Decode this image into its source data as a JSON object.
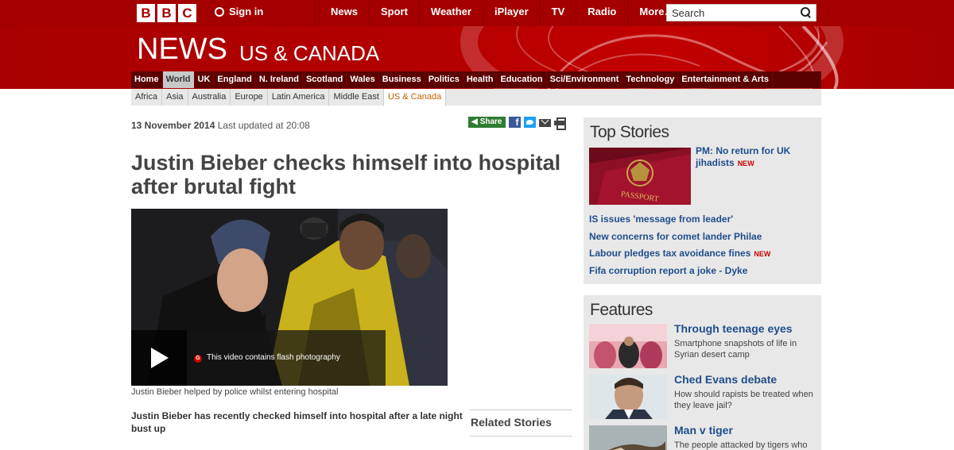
{
  "topbar": {
    "logo_letters": [
      "B",
      "B",
      "C"
    ],
    "signin_label": "Sign in",
    "nav": [
      "News",
      "Sport",
      "Weather",
      "iPlayer",
      "TV",
      "Radio",
      "More…"
    ],
    "search_placeholder": "Search"
  },
  "masthead": {
    "title": "NEWS",
    "section": "US & CANADA"
  },
  "nav_primary": [
    "Home",
    "World",
    "UK",
    "England",
    "N. Ireland",
    "Scotland",
    "Wales",
    "Business",
    "Politics",
    "Health",
    "Education",
    "Sci/Environment",
    "Technology",
    "Entertainment & Arts"
  ],
  "nav_primary_active": "World",
  "nav_secondary": [
    "Africa",
    "Asia",
    "Australia",
    "Europe",
    "Latin America",
    "Middle East",
    "US & Canada"
  ],
  "nav_secondary_active": "US & Canada",
  "article": {
    "date": "13 November 2014",
    "updated": "Last updated at 20:08",
    "share_label": "Share",
    "headline": "Justin Bieber checks himself into hospital after brutal fight",
    "video_warning": "This video contains flash photography",
    "video_warning_badge": "G",
    "caption": "Justin Bieber helped by police whilst entering hospital",
    "intro": "Justin Bieber has recently checked himself into hospital after a late night bust up",
    "related_heading": "Related Stories"
  },
  "top_stories": {
    "title": "Top Stories",
    "lead": "PM: No return for UK jihadists",
    "lead_badge": "NEW",
    "lead_image_text": "PASSPORT",
    "items": [
      {
        "text": "IS issues 'message from leader'",
        "badge": ""
      },
      {
        "text": "New concerns for comet lander Philae",
        "badge": ""
      },
      {
        "text": "Labour pledges tax avoidance fines",
        "badge": "NEW"
      },
      {
        "text": "Fifa corruption report a joke - Dyke",
        "badge": ""
      }
    ]
  },
  "features": {
    "title": "Features",
    "items": [
      {
        "title": "Through teenage eyes",
        "desc": "Smartphone snapshots of life in Syrian desert camp"
      },
      {
        "title": "Ched Evans debate",
        "desc": "How should rapists be treated when they leave jail?"
      },
      {
        "title": "Man v tiger",
        "desc": "The people attacked by tigers who"
      }
    ]
  },
  "colors": {
    "bbc_red": "#a50000",
    "nav_dark": "#5a0000",
    "link_blue": "#1f4e8c",
    "new_red": "#cc0000",
    "active_orange": "#c46100"
  }
}
